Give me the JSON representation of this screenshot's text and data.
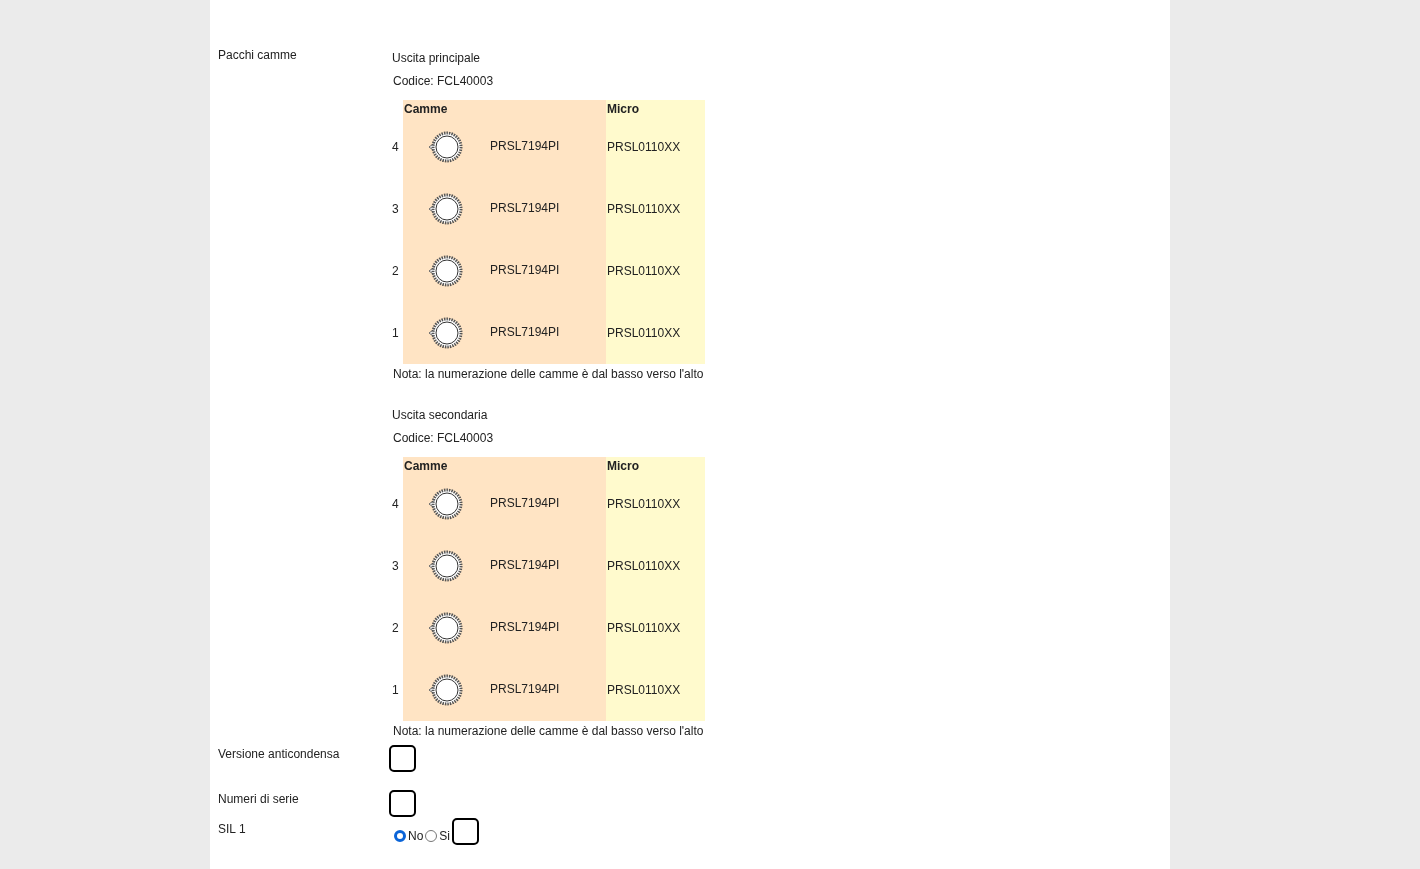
{
  "cam_packs": {
    "label": "Pacchi camme",
    "outputs": [
      {
        "title": "Uscita principale",
        "code": "Codice: FCL40003",
        "headers": [
          "Camme",
          "Micro"
        ],
        "rows": [
          {
            "number": "4",
            "cam": "PRSL7194PI",
            "micro": "PRSL0110XX"
          },
          {
            "number": "3",
            "cam": "PRSL7194PI",
            "micro": "PRSL0110XX"
          },
          {
            "number": "2",
            "cam": "PRSL7194PI",
            "micro": "PRSL0110XX"
          },
          {
            "number": "1",
            "cam": "PRSL7194PI",
            "micro": "PRSL0110XX"
          }
        ],
        "note": "Nota: la numerazione delle camme è dal basso verso l'alto"
      },
      {
        "title": "Uscita secondaria",
        "code": "Codice: FCL40003",
        "headers": [
          "Camme",
          "Micro"
        ],
        "rows": [
          {
            "number": "4",
            "cam": "PRSL7194PI",
            "micro": "PRSL0110XX"
          },
          {
            "number": "3",
            "cam": "PRSL7194PI",
            "micro": "PRSL0110XX"
          },
          {
            "number": "2",
            "cam": "PRSL7194PI",
            "micro": "PRSL0110XX"
          },
          {
            "number": "1",
            "cam": "PRSL7194PI",
            "micro": "PRSL0110XX"
          }
        ],
        "note": "Nota: la numerazione delle camme è dal basso verso l'alto"
      }
    ]
  },
  "options": [
    {
      "kind": "checkbox",
      "label": "Versione anticondensa",
      "checked": false
    },
    {
      "kind": "checkbox",
      "label": "Numeri di serie",
      "checked": false
    },
    {
      "kind": "radio",
      "label": "SIL 1",
      "choices": [
        {
          "label": "No",
          "selected": true
        },
        {
          "label": "Si",
          "selected": false
        }
      ],
      "checked": false
    }
  ]
}
